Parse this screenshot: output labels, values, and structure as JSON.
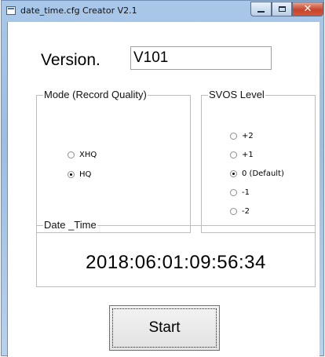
{
  "window": {
    "title": "date_time.cfg Creator V2.1",
    "minimize_icon": "minimize-icon",
    "maximize_icon": "maximize-icon",
    "close_icon": "close-icon"
  },
  "version": {
    "label": "Version.",
    "value": "V101"
  },
  "mode_group": {
    "legend": "Mode (Record Quality)",
    "options": [
      {
        "label": "XHQ",
        "selected": false
      },
      {
        "label": "HQ",
        "selected": true
      }
    ]
  },
  "svos_group": {
    "legend": "SVOS Level",
    "options": [
      {
        "label": "+2",
        "selected": false
      },
      {
        "label": "+1",
        "selected": false
      },
      {
        "label": "0 (Default)",
        "selected": true
      },
      {
        "label": "-1",
        "selected": false
      },
      {
        "label": "-2",
        "selected": false
      }
    ]
  },
  "date_group": {
    "legend": "Date _Time",
    "value": "2018:06:01:09:56:34"
  },
  "start_button": {
    "label": "Start"
  }
}
